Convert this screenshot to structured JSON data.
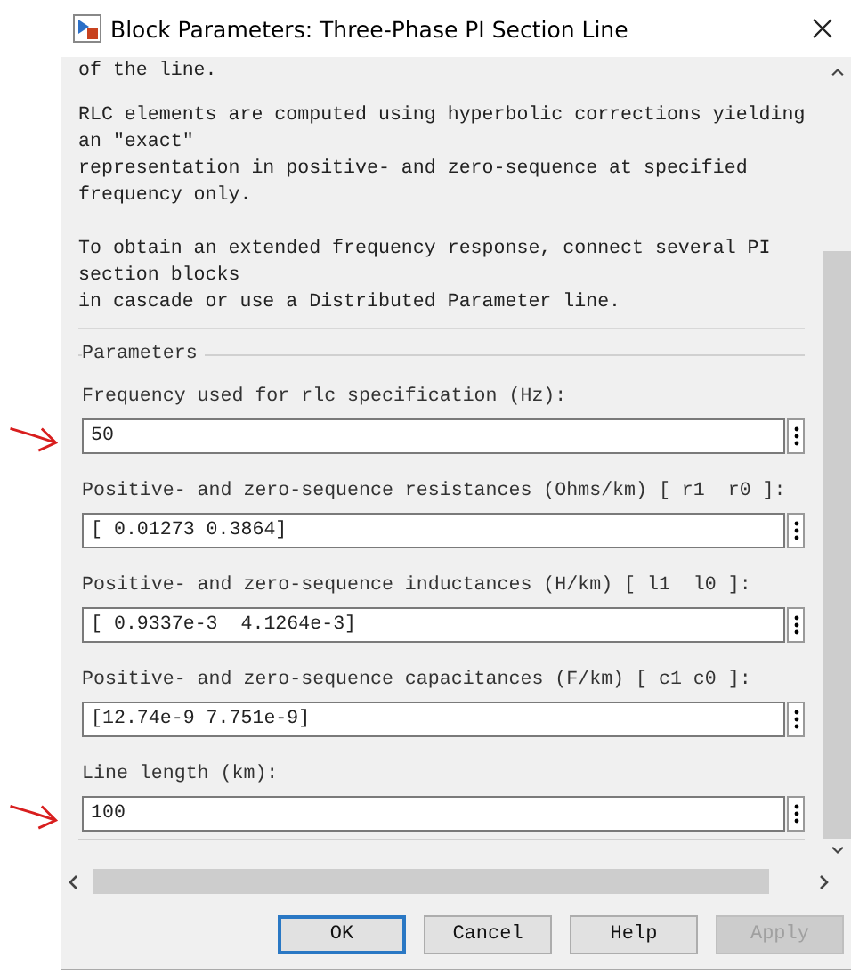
{
  "window": {
    "title": "Block Parameters: Three-Phase PI Section Line"
  },
  "description": [
    "of the line.",
    "RLC elements are computed using hyperbolic corrections yielding\nan ″exact″\nrepresentation in positive- and zero-sequence at specified\nfrequency only.",
    "To obtain an extended frequency response, connect several PI\nsection blocks\nin cascade or use a Distributed Parameter line."
  ],
  "parameters": {
    "title": "Parameters",
    "items": [
      {
        "label": "Frequency used for rlc specification (Hz):",
        "value": "50",
        "marked": true
      },
      {
        "label": "Positive- and zero-sequence resistances (Ohms/km) [ r1  r0 ]:",
        "value": "[ 0.01273 0.3864]",
        "marked": false
      },
      {
        "label": "Positive- and zero-sequence inductances (H/km) [ l1  l0 ]:",
        "value": "[ 0.9337e-3  4.1264e-3]",
        "marked": false
      },
      {
        "label": "Positive- and zero-sequence capacitances (F/km) [ c1 c0 ]:",
        "value": "[12.74e-9 7.751e-9]",
        "marked": false
      },
      {
        "label": "Line length (km):",
        "value": "100",
        "marked": true
      }
    ]
  },
  "buttons": [
    {
      "label": "OK",
      "disabled": false,
      "default": true
    },
    {
      "label": "Cancel",
      "disabled": false,
      "default": false
    },
    {
      "label": "Help",
      "disabled": false,
      "default": false
    },
    {
      "label": "Apply",
      "disabled": true,
      "default": false
    }
  ]
}
